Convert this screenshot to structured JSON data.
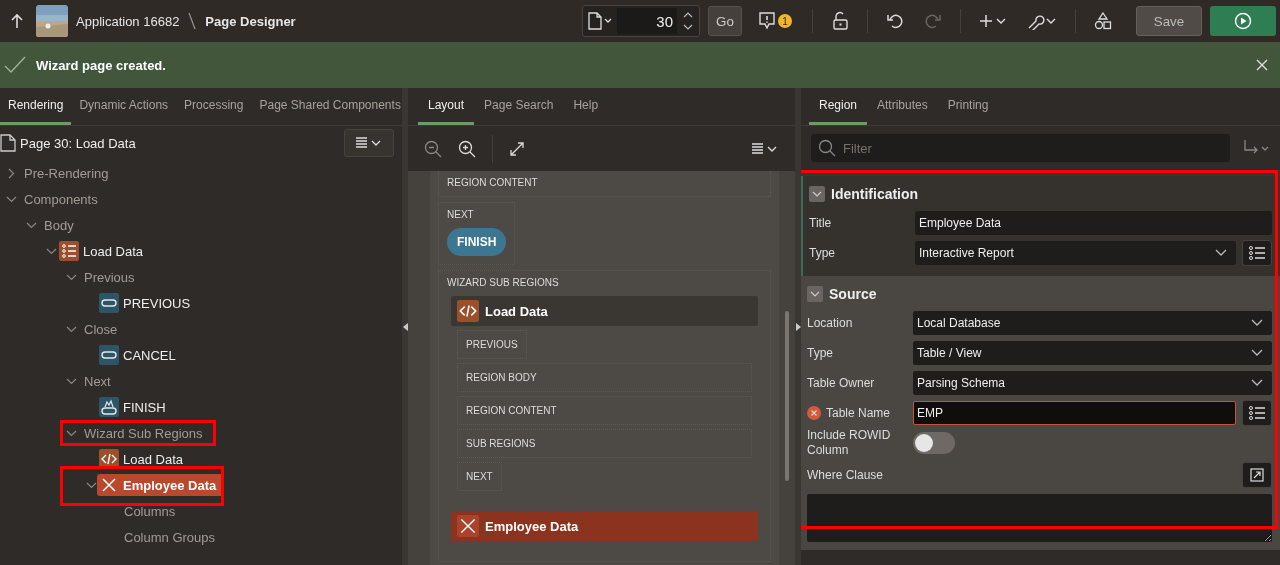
{
  "header": {
    "app": "Application 16682",
    "page": "Page Designer",
    "page_number": "30",
    "go": "Go",
    "badge": "1",
    "save": "Save",
    "tools": [
      {
        "kind": "undo",
        "disabled": false
      },
      {
        "kind": "redo",
        "disabled": true
      }
    ]
  },
  "notice": {
    "text": "Wizard page created."
  },
  "rendering": {
    "tabs": [
      {
        "label": "Rendering",
        "selected": true
      },
      {
        "label": "Dynamic Actions",
        "selected": false
      },
      {
        "label": "Processing",
        "selected": false
      },
      {
        "label": "Page Shared Components",
        "selected": false
      }
    ],
    "page": "Page 30: Load Data",
    "tree": [
      {
        "label": "Pre-Rendering",
        "kind": "group",
        "expanded": false,
        "selected": false,
        "highlighted": false
      },
      {
        "label": "Components",
        "kind": "group",
        "expanded": true,
        "selected": false,
        "highlighted": false,
        "children": [
          {
            "label": "Body",
            "kind": "group",
            "expanded": true,
            "selected": false,
            "highlighted": false,
            "children": [
              {
                "label": "Load Data",
                "kind": "report",
                "expanded": true,
                "selected": false,
                "highlighted": false,
                "children": [
                  {
                    "label": "Previous",
                    "kind": "group",
                    "expanded": true,
                    "selected": false,
                    "highlighted": false,
                    "children": [
                      {
                        "label": "PREVIOUS",
                        "kind": "button",
                        "selected": false,
                        "highlighted": false
                      }
                    ]
                  },
                  {
                    "label": "Close",
                    "kind": "group",
                    "expanded": true,
                    "selected": false,
                    "highlighted": false,
                    "children": [
                      {
                        "label": "CANCEL",
                        "kind": "button",
                        "selected": false,
                        "highlighted": false
                      }
                    ]
                  },
                  {
                    "label": "Next",
                    "kind": "group",
                    "expanded": true,
                    "selected": false,
                    "highlighted": false,
                    "children": [
                      {
                        "label": "FINISH",
                        "kind": "hot-button",
                        "selected": false,
                        "highlighted": false
                      }
                    ]
                  },
                  {
                    "label": "Wizard Sub Regions",
                    "kind": "group",
                    "expanded": true,
                    "selected": false,
                    "highlighted": true,
                    "children": [
                      {
                        "label": "Load Data",
                        "kind": "code",
                        "selected": false,
                        "highlighted": false
                      },
                      {
                        "label": "Employee Data",
                        "kind": "error",
                        "expanded": true,
                        "selected": true,
                        "highlighted": true,
                        "children": [
                          {
                            "label": "Columns",
                            "kind": "group",
                            "selected": false,
                            "highlighted": false
                          },
                          {
                            "label": "Column Groups",
                            "kind": "group",
                            "selected": false,
                            "highlighted": false
                          }
                        ]
                      }
                    ]
                  }
                ]
              }
            ]
          }
        ]
      }
    ]
  },
  "layout": {
    "tabs": [
      {
        "label": "Layout",
        "selected": true
      },
      {
        "label": "Page Search",
        "selected": false
      },
      {
        "label": "Help",
        "selected": false
      }
    ],
    "blocks": [
      {
        "label": "REGION CONTENT"
      },
      {
        "label": "NEXT",
        "buttons": [
          "FINISH"
        ]
      },
      {
        "label": "WIZARD SUB REGIONS",
        "regions": [
          {
            "title": "Load Data",
            "kind": "code",
            "selected": false,
            "slots": [
              {
                "label": "PREVIOUS",
                "kind": "button"
              },
              {
                "label": "REGION BODY",
                "kind": "body"
              },
              {
                "label": "REGION CONTENT",
                "kind": "body"
              },
              {
                "label": "SUB REGIONS",
                "kind": "body"
              },
              {
                "label": "NEXT",
                "kind": "button"
              }
            ]
          },
          {
            "title": "Employee Data",
            "kind": "error",
            "selected": true
          }
        ]
      }
    ]
  },
  "properties": {
    "tabs": [
      {
        "label": "Region",
        "selected": true
      },
      {
        "label": "Attributes",
        "selected": false
      },
      {
        "label": "Printing",
        "selected": false
      }
    ],
    "filter": {
      "placeholder": "Filter"
    },
    "highlighted": true,
    "sections": [
      {
        "title": "Identification",
        "current": true,
        "rows": [
          {
            "label": "Title",
            "kind": "text",
            "value": "Employee Data"
          },
          {
            "label": "Type",
            "kind": "select",
            "value": "Interactive Report",
            "lov": true
          }
        ]
      },
      {
        "title": "Source",
        "current": false,
        "rows": [
          {
            "label": "Location",
            "kind": "select",
            "value": "Local Database"
          },
          {
            "label": "Type",
            "kind": "select",
            "value": "Table / View"
          },
          {
            "label": "Table Owner",
            "kind": "select",
            "value": "Parsing Schema"
          },
          {
            "label": "Table Name",
            "kind": "text",
            "value": "EMP",
            "error": true,
            "lov": true
          },
          {
            "label": "Include ROWID Column",
            "kind": "switch",
            "on": false
          },
          {
            "label": "Where Clause",
            "kind": "code"
          }
        ]
      }
    ]
  }
}
